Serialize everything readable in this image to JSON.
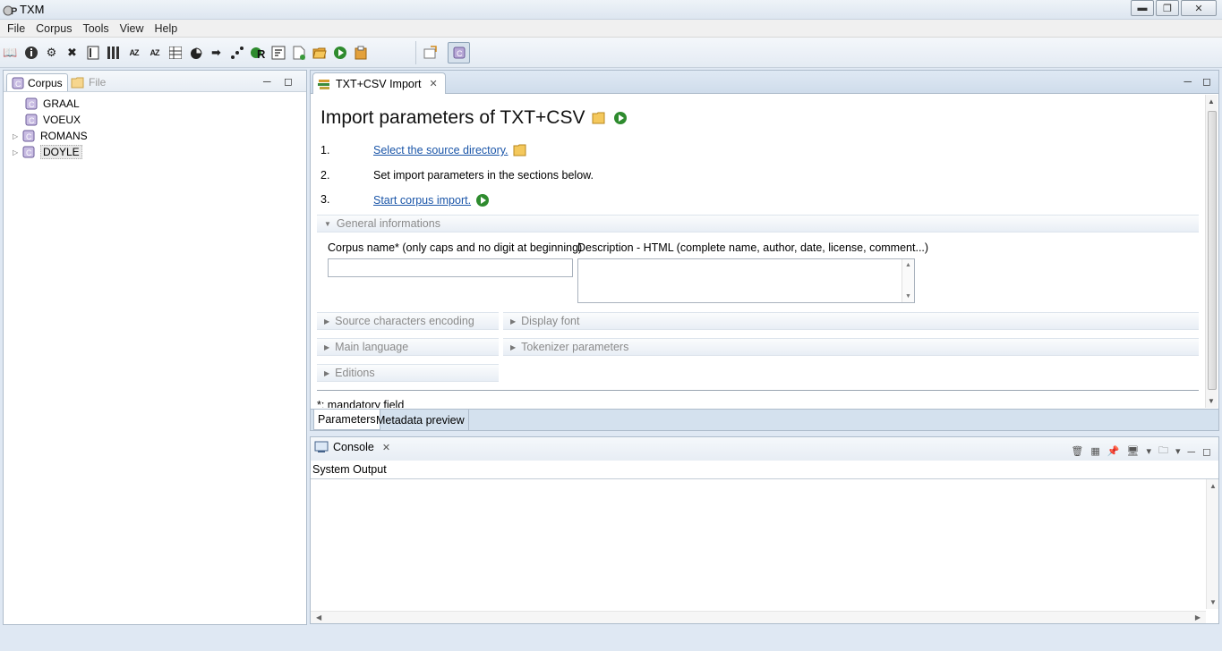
{
  "window": {
    "title": "TXM"
  },
  "menubar": {
    "items": [
      "File",
      "Corpus",
      "Tools",
      "View",
      "Help"
    ]
  },
  "toolbar": {
    "icons": [
      "open-book-icon",
      "info-icon",
      "gear-icon",
      "close-icon",
      "text-icon",
      "columns-icon",
      "az-icon",
      "za-icon",
      "table-icon",
      "pie-icon",
      "arrows-icon",
      "scatter-icon",
      "r-icon",
      "sort-icon",
      "new-file-icon",
      "folder-open-icon",
      "run-icon",
      "clipboard-icon"
    ],
    "labels": {
      "az": "AZ",
      "za": "AZ"
    }
  },
  "left_panel": {
    "tabs": {
      "corpus": "Corpus",
      "file": "File"
    },
    "tree": [
      {
        "label": "GRAAL",
        "expandable": false
      },
      {
        "label": "VOEUX",
        "expandable": false
      },
      {
        "label": "ROMANS",
        "expandable": true
      },
      {
        "label": "DOYLE",
        "expandable": true,
        "selected": true
      }
    ]
  },
  "editor": {
    "tab_label": "TXT+CSV Import",
    "title": "Import parameters of TXT+CSV",
    "steps": [
      {
        "num": "1.",
        "text": "Select the source directory.",
        "link": true
      },
      {
        "num": "2.",
        "text": "Set import parameters in the sections below.",
        "link": false
      },
      {
        "num": "3.",
        "text": "Start corpus import.",
        "link": true
      }
    ],
    "sections": {
      "general": "General informations",
      "encoding": "Source characters encoding",
      "display_font": "Display font",
      "main_language": "Main language",
      "tokenizer": "Tokenizer parameters",
      "editions": "Editions"
    },
    "fields": {
      "corpus_name_label": "Corpus name* (only caps and no digit at beginning)",
      "corpus_name_value": "",
      "description_label": "Description - HTML (complete name, author, date, license, comment...)",
      "description_value": ""
    },
    "mandatory_note": "*: mandatory field",
    "bottom_tabs": [
      "Parameters",
      "Metadata preview"
    ]
  },
  "console": {
    "tab_label": "Console",
    "output_label": "System Output"
  },
  "colors": {
    "link": "#1a55a8",
    "panel_border": "#aebccb",
    "section_text": "#8a8a8a",
    "run_green": "#2e8b2e"
  }
}
